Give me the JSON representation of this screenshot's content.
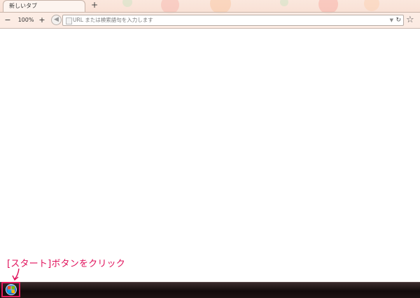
{
  "browser": {
    "tab_title": "新しいタブ",
    "new_tab_label": "+",
    "zoom": {
      "minus_label": "−",
      "value": "100%",
      "plus_label": "+"
    },
    "omnibox_placeholder": "URL または検索語句を入力します",
    "icons": [
      "back-arrow-icon",
      "page-icon",
      "dropdown-icon",
      "reload-icon",
      "star-icon"
    ]
  },
  "annotation": {
    "text": "[スタート]ボタンをクリック",
    "color": "#e0105a"
  },
  "taskbar": {
    "start_button_icon": "windows-start-orb-icon",
    "highlight_color": "#e21b5d"
  }
}
